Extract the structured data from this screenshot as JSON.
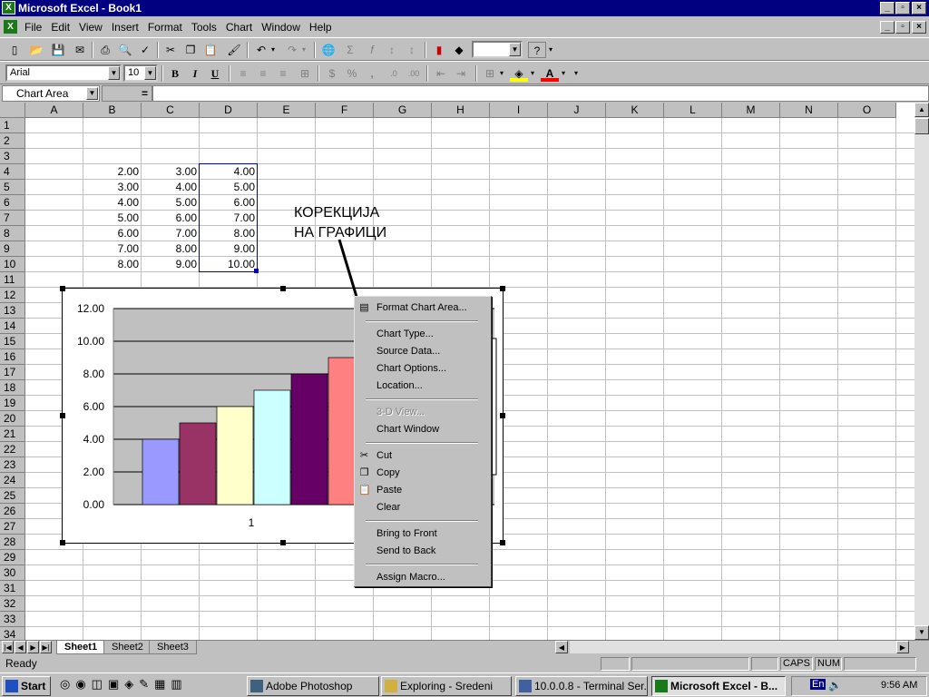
{
  "window": {
    "title": "Microsoft Excel - Book1",
    "icon": "excel-icon"
  },
  "menu": [
    "File",
    "Edit",
    "View",
    "Insert",
    "Format",
    "Tools",
    "Chart",
    "Window",
    "Help"
  ],
  "format_toolbar": {
    "font": "Arial",
    "size": "10",
    "bold": "B",
    "italic": "I",
    "underline": "U",
    "currency": "$",
    "percent": "%",
    "comma": ","
  },
  "name_box": "Chart Area",
  "formula_eq": "=",
  "columns": [
    "A",
    "B",
    "C",
    "D",
    "E",
    "F",
    "G",
    "H",
    "I",
    "J",
    "K",
    "L",
    "M",
    "N",
    "O"
  ],
  "rows": [
    "1",
    "2",
    "3",
    "4",
    "5",
    "6",
    "7",
    "8",
    "9",
    "10",
    "11",
    "12",
    "13",
    "14",
    "15",
    "16",
    "17",
    "18",
    "19",
    "20",
    "21",
    "22",
    "23",
    "24",
    "25",
    "26",
    "27",
    "28",
    "29",
    "30",
    "31",
    "32",
    "33",
    "34"
  ],
  "table": {
    "B": [
      "2.00",
      "3.00",
      "4.00",
      "5.00",
      "6.00",
      "7.00",
      "8.00"
    ],
    "C": [
      "3.00",
      "4.00",
      "5.00",
      "6.00",
      "7.00",
      "8.00",
      "9.00"
    ],
    "D": [
      "4.00",
      "5.00",
      "6.00",
      "7.00",
      "8.00",
      "9.00",
      "10.00"
    ]
  },
  "annotation": {
    "line1": "КОРЕКЦИЈА",
    "line2": "НА ГРАФИЦИ"
  },
  "chart_data": {
    "type": "bar",
    "categories": [
      "1"
    ],
    "series": [
      {
        "values": [
          4
        ],
        "color": "#9999ff"
      },
      {
        "values": [
          5
        ],
        "color": "#993366"
      },
      {
        "values": [
          6
        ],
        "color": "#ffffcc"
      },
      {
        "values": [
          7
        ],
        "color": "#ccffff"
      },
      {
        "values": [
          8
        ],
        "color": "#660066"
      },
      {
        "values": [
          9
        ],
        "color": "#ff8080"
      }
    ],
    "ylim": [
      0,
      12
    ],
    "yticks": [
      "12.00",
      "10.00",
      "8.00",
      "6.00",
      "4.00",
      "2.00",
      "0.00"
    ],
    "plot_bg": "#c0c0c0",
    "grid": true
  },
  "context_menu": {
    "items": [
      {
        "label": "Format Chart Area...",
        "icon": "format-chart-icon",
        "enabled": true
      },
      {
        "sep": true
      },
      {
        "label": "Chart Type...",
        "enabled": true
      },
      {
        "label": "Source Data...",
        "enabled": true
      },
      {
        "label": "Chart Options...",
        "enabled": true
      },
      {
        "label": "Location...",
        "enabled": true
      },
      {
        "sep": true
      },
      {
        "label": "3-D View...",
        "enabled": false
      },
      {
        "label": "Chart Window",
        "enabled": true
      },
      {
        "sep": true
      },
      {
        "label": "Cut",
        "icon": "scissors-icon",
        "enabled": true
      },
      {
        "label": "Copy",
        "icon": "copy-icon",
        "enabled": true
      },
      {
        "label": "Paste",
        "icon": "paste-icon",
        "enabled": true
      },
      {
        "label": "Clear",
        "enabled": true
      },
      {
        "sep": true
      },
      {
        "label": "Bring to Front",
        "enabled": true
      },
      {
        "label": "Send to Back",
        "enabled": true
      },
      {
        "sep": true
      },
      {
        "label": "Assign Macro...",
        "enabled": true
      }
    ]
  },
  "sheets": [
    "Sheet1",
    "Sheet2",
    "Sheet3"
  ],
  "status": {
    "text": "Ready",
    "caps": "CAPS",
    "num": "NUM"
  },
  "taskbar": {
    "start": "Start",
    "tasks": [
      "Adobe Photoshop",
      "Exploring - Sredeni",
      "10.0.0.8 - Terminal Ser...",
      "Microsoft Excel - B..."
    ],
    "lang": "En",
    "clock": "9:56 AM"
  }
}
